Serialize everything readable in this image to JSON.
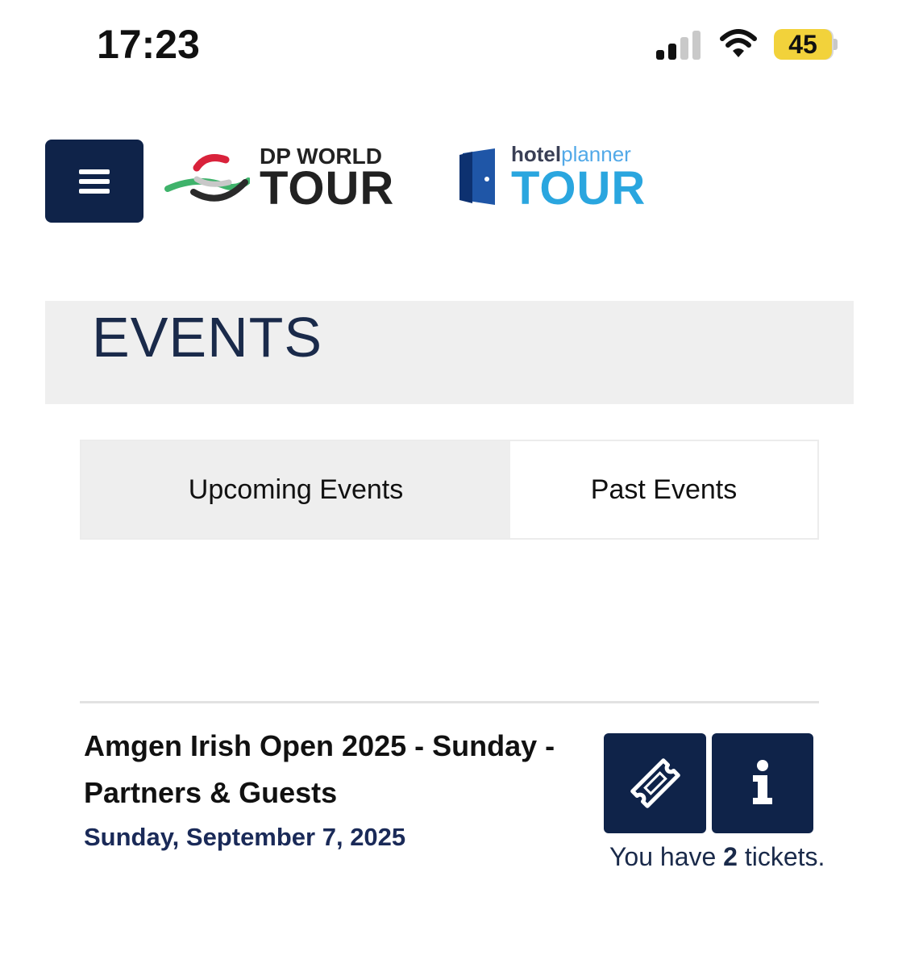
{
  "status_bar": {
    "time": "17:23",
    "battery": "45",
    "icons": [
      "signal-icon",
      "wifi-icon",
      "battery-icon"
    ]
  },
  "header": {
    "menu_icon": "hamburger-icon",
    "logos": [
      {
        "small": "DP WORLD",
        "big": "TOUR"
      },
      {
        "small_a": "hotel",
        "small_b": "planner",
        "big": "TOUR"
      }
    ]
  },
  "page": {
    "title": "EVENTS"
  },
  "tabs": [
    {
      "label": "Upcoming Events",
      "selected": true
    },
    {
      "label": "Past Events",
      "selected": false
    }
  ],
  "event": {
    "title": "Amgen Irish Open 2025 - Sunday - Partners & Guests",
    "date": "Sunday, September 7, 2025",
    "ticket_prefix": "You have",
    "ticket_count": "2",
    "ticket_suffix": "tickets.",
    "ticket_button_icon": "ticket-icon",
    "info_button_icon": "info-icon"
  },
  "colors": {
    "navy": "#0f2349",
    "band": "#efefef",
    "battery": "#f2d23b"
  }
}
